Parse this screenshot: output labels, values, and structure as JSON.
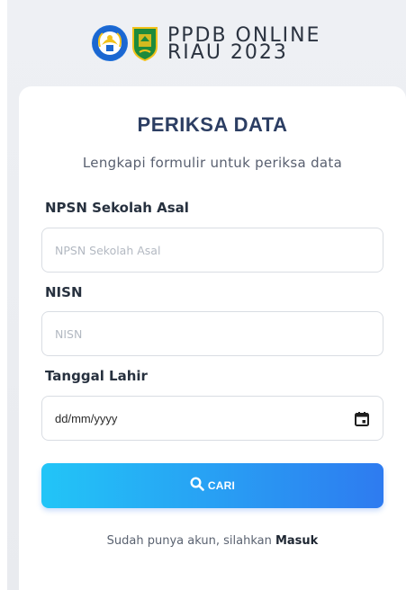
{
  "header": {
    "brand_line1": "PPDB ONLINE",
    "brand_line2": "RIAU 2023"
  },
  "card": {
    "title": "PERIKSA DATA",
    "subtitle": "Lengkapi formulir untuk periksa data"
  },
  "form": {
    "npsn": {
      "label": "NPSN Sekolah Asal",
      "placeholder": "NPSN Sekolah Asal",
      "value": ""
    },
    "nisn": {
      "label": "NISN",
      "placeholder": "NISN",
      "value": ""
    },
    "tanggal_lahir": {
      "label": "Tanggal Lahir",
      "display": "dd/mm/yyyy"
    },
    "search_button": {
      "label": "CARI",
      "icon": "search-icon"
    }
  },
  "footer": {
    "text": "Sudah punya akun, silahkan",
    "link": "Masuk"
  },
  "colors": {
    "button_start": "#22c5f7",
    "button_end": "#2e7bf0",
    "title": "#2c3e63"
  }
}
